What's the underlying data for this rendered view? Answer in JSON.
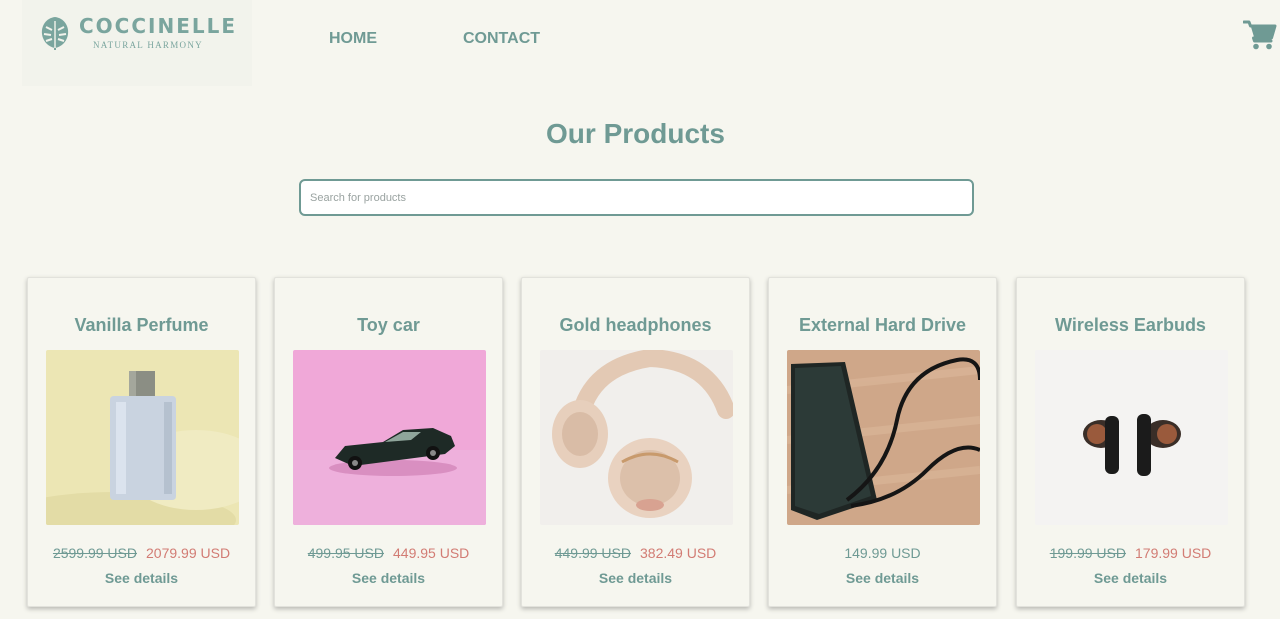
{
  "brand": {
    "name": "COCCINELLE",
    "tagline": "NATURAL HARMONY",
    "color": "#7aa59e"
  },
  "nav": {
    "home": "HOME",
    "contact": "CONTACT",
    "cart_icon": "shopping-cart-icon"
  },
  "main": {
    "title": "Our Products",
    "search_placeholder": "Search for products"
  },
  "colors": {
    "accent": "#6f9a94",
    "sale": "#d27c74",
    "background": "#f6f6ef"
  },
  "products": [
    {
      "title": "Vanilla Perfume",
      "old_price": "2599.99 USD",
      "price": "2079.99 USD",
      "details": "See details",
      "image": "perfume-bottle"
    },
    {
      "title": "Toy car",
      "old_price": "499.95 USD",
      "price": "449.95 USD",
      "details": "See details",
      "image": "toy-car"
    },
    {
      "title": "Gold headphones",
      "old_price": "449.99 USD",
      "price": "382.49 USD",
      "details": "See details",
      "image": "headphones"
    },
    {
      "title": "External Hard Drive",
      "old_price": "",
      "price": "149.99 USD",
      "details": "See details",
      "image": "hard-drive"
    },
    {
      "title": "Wireless Earbuds",
      "old_price": "199.99 USD",
      "price": "179.99 USD",
      "details": "See details",
      "image": "earbuds"
    }
  ]
}
